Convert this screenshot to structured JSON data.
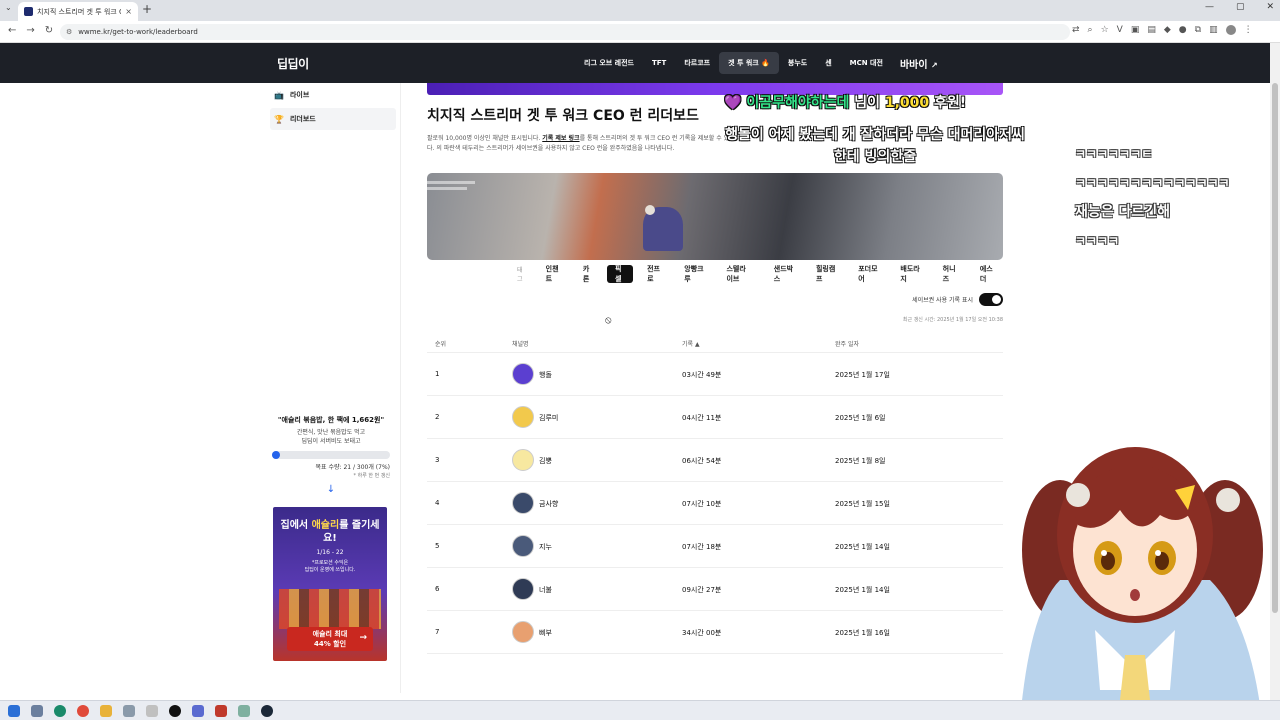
{
  "browser": {
    "tab_title": "치지직 스트리머 겟 투 워크 C...",
    "tab_close": "×",
    "new_tab": "+",
    "url": "wwme.kr/get-to-work/leaderboard"
  },
  "site": {
    "logo": "딥딥이",
    "nav": [
      "리그 오브 레전드",
      "TFT",
      "타르코프",
      "겟 투 워크 🔥",
      "봉누도",
      "센",
      "MCN 대전"
    ],
    "brand": "바바이",
    "brand_icon": "external-link-icon"
  },
  "sidebar": {
    "items": [
      {
        "label": "라이브",
        "icon": "tv-icon"
      },
      {
        "label": "리더보드",
        "icon": "trophy-icon"
      }
    ],
    "fund": {
      "title": "\"애슐리 볶음밥, 한 팩에 1,662원\"",
      "desc_line1": "간편식, 맛난 볶음밥도 먹고",
      "desc_line2": "딥딥이 서버비도 보태고",
      "progress": 0.07,
      "count": "목표 수량: 21 / 300개 (7%)",
      "note": "* 하루 한 번 갱신",
      "arrow": "↓"
    },
    "ad": {
      "title_pre": "집에서 ",
      "title_hl": "애슐리",
      "title_post": "를 즐기세요!",
      "date": "1/16 - 22",
      "desc_line1": "*프로모션 수익은",
      "desc_line2": "딥딥이 운영에 쓰입니다.",
      "cta_line1": "애슐리 최대",
      "cta_line2": "44% 할인",
      "cta_arrow": "→"
    }
  },
  "main": {
    "title": "치지직 스트리머 겟 투 워크 CEO 런 리더보드",
    "desc_pre": "팔로워 10,000명 이상인 채널만 표시됩니다. ",
    "desc_link": "기록 제보 링크",
    "desc_post": "를 통해 스트리머의 겟 투 워크 CEO 런 기록을 제보할 수 있습니다. 의 파란색 테두리는 스트리머가 세이브권을 사용하지 않고 CEO 런을 완주하였음을 나타냅니다.",
    "tags_label": "태그",
    "tags": [
      "인챈트",
      "카론",
      "픽셀",
      "전프로",
      "앙빵크루",
      "스텔라이브",
      "샌드박스",
      "힐링캠프",
      "포더모어",
      "배도라지",
      "허니즈",
      "에스더"
    ],
    "active_tag": 2,
    "toggle_label": "세이브권 사용 기록 표시",
    "updated": "최근 갱신 시간: 2025년 1월 17일 오전 10:38",
    "columns": {
      "rank": "순위",
      "channel": "채널명",
      "record": "기록 ▲",
      "date": "완주 일자"
    },
    "rows": [
      {
        "rank": "1",
        "name": "행돌",
        "record": "03시간 49분",
        "date": "2025년 1월 17일",
        "color": "#5b3fd0"
      },
      {
        "rank": "2",
        "name": "김루미",
        "record": "04시간 11분",
        "date": "2025년 1월 6일",
        "color": "#f2c94c"
      },
      {
        "rank": "3",
        "name": "김뿡",
        "record": "06시간 54분",
        "date": "2025년 1월 8일",
        "color": "#f7e8a0"
      },
      {
        "rank": "4",
        "name": "금사향",
        "record": "07시간 10분",
        "date": "2025년 1월 15일",
        "color": "#3a4a6a"
      },
      {
        "rank": "5",
        "name": "지누",
        "record": "07시간 18분",
        "date": "2025년 1월 14일",
        "color": "#4a5a7a"
      },
      {
        "rank": "6",
        "name": "너불",
        "record": "09시간 27분",
        "date": "2025년 1월 14일",
        "color": "#2f3b55"
      },
      {
        "rank": "7",
        "name": "삐부",
        "record": "34시간 00분",
        "date": "2025년 1월 16일",
        "color": "#e8a070"
      }
    ]
  },
  "overlay": {
    "donation_name": "이곰무해야하는데",
    "donation_mid": " 님이 ",
    "donation_amount": "1,000",
    "donation_suffix": " 후원!",
    "donation_msg": "행돌이 어제 봤는데 개 잘하더라 무슨 대머리아저씨한테 빙의한줄",
    "chat": [
      "ㅋㅋㅋㅋㅋㅋㅌ",
      "ㅋㅋㅋㅋㅋㅋㅋㅋㅋㅋㅋㅋㅋㅋ",
      "재능은 다르긴해",
      "ㅋㅋㅋㅋ"
    ]
  }
}
